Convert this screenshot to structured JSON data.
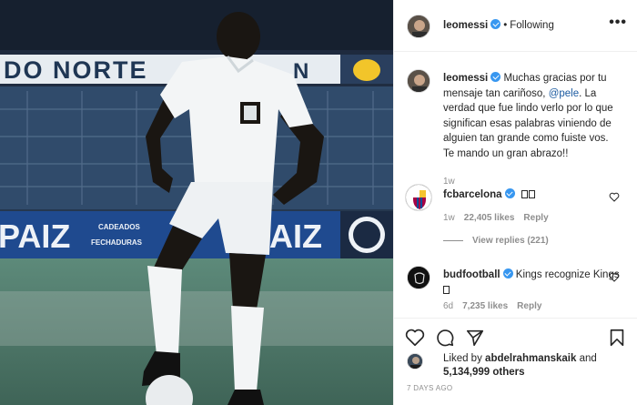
{
  "post": {
    "author": "leomessi",
    "follow_status": "Following",
    "more_label": "•••"
  },
  "caption": {
    "username": "leomessi",
    "text_before": "Muchas gracias por tu mensaje tan cariñoso, ",
    "mention": "@pele",
    "text_after": ". La verdad que fue lindo verlo por lo que significan esas palabras viniendo de alguien tan grande como fuiste vos. Te mando un gran abrazo!!",
    "age": "1w"
  },
  "photo": {
    "banner_left": "DO NORTE",
    "banner_right": "N",
    "board_left": "PAIZ",
    "board_small_1": "CADEADOS",
    "board_small_2": "FECHADURAS",
    "board_right": "AIZ"
  },
  "comments": [
    {
      "username": "fcbarcelona",
      "text": "",
      "age": "1w",
      "likes": "22,405 likes",
      "reply": "Reply"
    },
    {
      "username": "budfootball",
      "text": "Kings recognize Kings ",
      "age": "6d",
      "likes": "7,235 likes",
      "reply": "Reply"
    }
  ],
  "view_replies": "View replies (221)",
  "likes": {
    "prefix": "Liked by",
    "user": "abdelrahmanskaik",
    "conj": "and",
    "count": "5,134,999 others"
  },
  "timestamp": "7 DAYS AGO",
  "colors": {
    "verified": "#3897f0",
    "link": "#1b5aa0",
    "muted": "#8e8e8e"
  }
}
